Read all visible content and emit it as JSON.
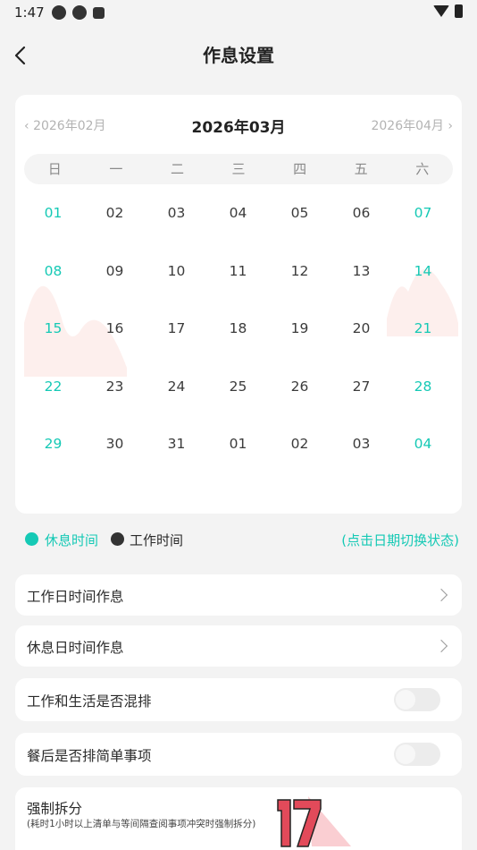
{
  "status_bar": {
    "time": "1:47",
    "icons": [
      "app-notification-icon",
      "app-notification-icon",
      "keyboard-a-icon"
    ],
    "right_icons": [
      "wifi-icon",
      "battery-icon"
    ]
  },
  "header": {
    "title": "作息设置",
    "back_icon": "chevron-left-icon"
  },
  "calendar": {
    "prev_month": "2026年02月",
    "current_month": "2026年03月",
    "next_month": "2026年04月",
    "weekdays": [
      "日",
      "一",
      "二",
      "三",
      "四",
      "五",
      "六"
    ],
    "days": [
      {
        "d": "01",
        "rest": true
      },
      {
        "d": "02",
        "rest": false
      },
      {
        "d": "03",
        "rest": false
      },
      {
        "d": "04",
        "rest": false
      },
      {
        "d": "05",
        "rest": false
      },
      {
        "d": "06",
        "rest": false
      },
      {
        "d": "07",
        "rest": true
      },
      {
        "d": "08",
        "rest": true
      },
      {
        "d": "09",
        "rest": false
      },
      {
        "d": "10",
        "rest": false
      },
      {
        "d": "11",
        "rest": false
      },
      {
        "d": "12",
        "rest": false
      },
      {
        "d": "13",
        "rest": false
      },
      {
        "d": "14",
        "rest": true
      },
      {
        "d": "15",
        "rest": true
      },
      {
        "d": "16",
        "rest": false
      },
      {
        "d": "17",
        "rest": false
      },
      {
        "d": "18",
        "rest": false
      },
      {
        "d": "19",
        "rest": false
      },
      {
        "d": "20",
        "rest": false
      },
      {
        "d": "21",
        "rest": true
      },
      {
        "d": "22",
        "rest": true
      },
      {
        "d": "23",
        "rest": false
      },
      {
        "d": "24",
        "rest": false
      },
      {
        "d": "25",
        "rest": false
      },
      {
        "d": "26",
        "rest": false
      },
      {
        "d": "27",
        "rest": false
      },
      {
        "d": "28",
        "rest": true
      },
      {
        "d": "29",
        "rest": true
      },
      {
        "d": "30",
        "rest": false
      },
      {
        "d": "31",
        "rest": false
      },
      {
        "d": "01",
        "rest": false
      },
      {
        "d": "02",
        "rest": false
      },
      {
        "d": "03",
        "rest": false
      },
      {
        "d": "04",
        "rest": true
      }
    ]
  },
  "legend": {
    "rest_label": "休息时间",
    "work_label": "工作时间",
    "hint": "(点击日期切换状态)",
    "rest_color": "#15c9b5",
    "work_color": "#333333"
  },
  "settings": {
    "workday_schedule": "工作日时间作息",
    "restday_schedule": "休息日时间作息",
    "mix_work_life": "工作和生活是否混排",
    "after_meal": "餐后是否排简单事项",
    "force_split": "强制拆分",
    "force_split_desc": "(耗时1小时以上清单与等间隔查阅事项冲突时强制拆分)"
  },
  "colors": {
    "accent": "#15c9b5",
    "background": "#f3f3f3",
    "card": "#ffffff",
    "muted_text": "#b3b3b3"
  }
}
